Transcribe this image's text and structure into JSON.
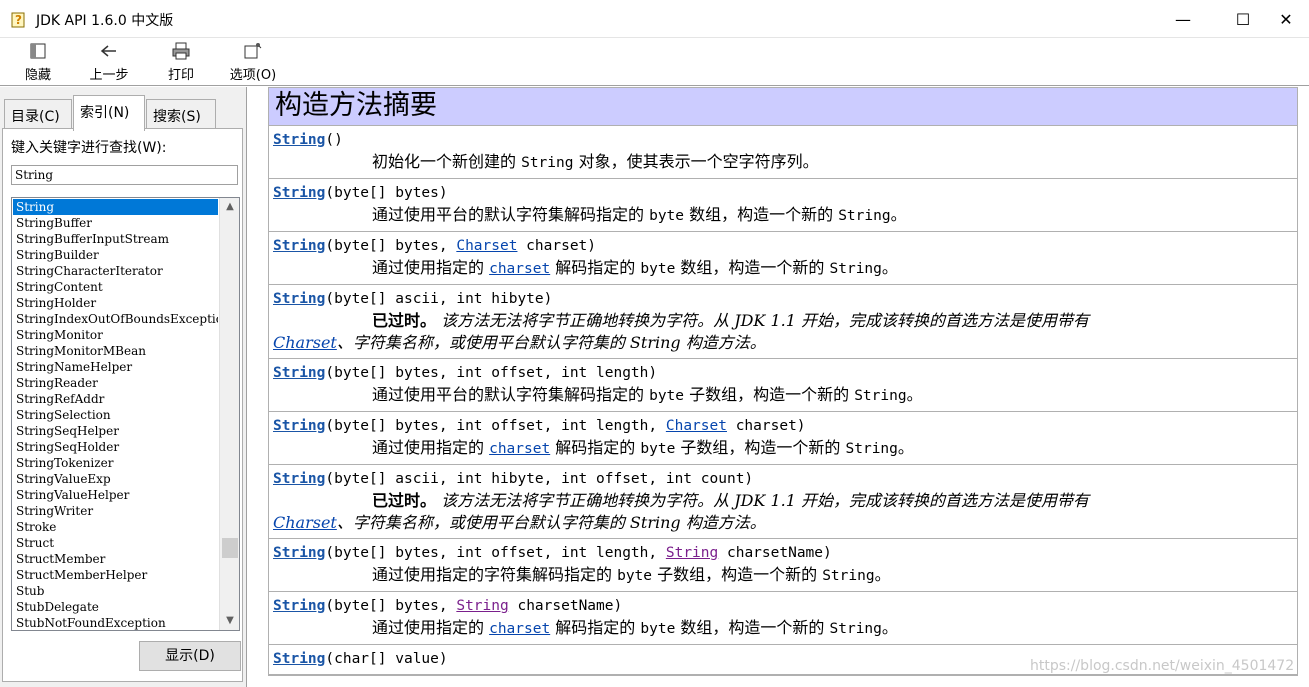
{
  "window": {
    "title": "JDK API 1.6.0 中文版",
    "min_glyph": "—",
    "max_glyph": "☐",
    "close_glyph": "✕"
  },
  "toolbar": {
    "hide_label": "隐藏",
    "back_label": "上一步",
    "print_label": "打印",
    "options_label": "选项(O)"
  },
  "tabs": {
    "contents": "目录(C)",
    "index": "索引(N)",
    "search": "搜索(S)"
  },
  "index": {
    "keyword_label": "键入关键字进行查找(W):",
    "keyword_value": "String",
    "items": [
      "String",
      "StringBuffer",
      "StringBufferInputStream",
      "StringBuilder",
      "StringCharacterIterator",
      "StringContent",
      "StringHolder",
      "StringIndexOutOfBoundsException",
      "StringMonitor",
      "StringMonitorMBean",
      "StringNameHelper",
      "StringReader",
      "StringRefAddr",
      "StringSelection",
      "StringSeqHelper",
      "StringSeqHolder",
      "StringTokenizer",
      "StringValueExp",
      "StringValueHelper",
      "StringWriter",
      "Stroke",
      "Struct",
      "StructMember",
      "StructMemberHelper",
      "Stub",
      "StubDelegate",
      "StubNotFoundException"
    ],
    "selected_item": "String",
    "show_button": "显示(D)"
  },
  "summary": {
    "heading": "构造方法摘要",
    "rows": [
      {
        "ctor": "String",
        "params": "()",
        "desc_pre": "初始化一个新创建的 ",
        "desc_code": "String",
        "desc_post": " 对象，使其表示一个空字符序列。"
      },
      {
        "ctor": "String",
        "params": "(byte[] bytes)",
        "desc_pre": "通过使用平台的默认字符集解码指定的 ",
        "desc_code": "byte",
        "desc_mid": " 数组，构造一个新的 ",
        "desc_code2": "String",
        "desc_post": "。"
      },
      {
        "ctor": "String",
        "params_pre": "(byte[] bytes, ",
        "link": "Charset",
        "params_post": " charset)",
        "desc_pre": "通过使用指定的 ",
        "desc_link": "charset",
        "desc_mid": " 解码指定的 ",
        "desc_code": "byte",
        "desc_mid2": " 数组，构造一个新的 ",
        "desc_code2": "String",
        "desc_post": "。"
      },
      {
        "ctor": "String",
        "params": "(byte[] ascii, int hibyte)",
        "dep_bold": "已过时。",
        "dep_text": " 该方法无法将字节正确地转换为字符。从 JDK 1.1 开始，完成该转换的首选方法是使用带有",
        "dep_link": "Charset",
        "dep_text2": "、字符集名称，或使用平台默认字符集的 String 构造方法。"
      },
      {
        "ctor": "String",
        "params": "(byte[] bytes, int offset, int length)",
        "desc_pre": "通过使用平台的默认字符集解码指定的 ",
        "desc_code": "byte",
        "desc_mid": " 子数组，构造一个新的 ",
        "desc_code2": "String",
        "desc_post": "。"
      },
      {
        "ctor": "String",
        "params_pre": "(byte[] bytes, int offset, int length, ",
        "link": "Charset",
        "params_post": " charset)",
        "desc_pre": "通过使用指定的 ",
        "desc_link": "charset",
        "desc_mid": " 解码指定的 ",
        "desc_code": "byte",
        "desc_mid2": " 子数组，构造一个新的 ",
        "desc_code2": "String",
        "desc_post": "。"
      },
      {
        "ctor": "String",
        "params": "(byte[] ascii, int hibyte, int offset, int count)",
        "dep_bold": "已过时。",
        "dep_text": " 该方法无法将字节正确地转换为字符。从 JDK 1.1 开始，完成该转换的首选方法是使用带有",
        "dep_link": "Charset",
        "dep_text2": "、字符集名称，或使用平台默认字符集的 String 构造方法。"
      },
      {
        "ctor": "String",
        "params_pre": "(byte[] bytes, int offset, int length, ",
        "link": "String",
        "params_post": " charsetName)",
        "desc_pre": "通过使用指定的字符集解码指定的 ",
        "desc_code": "byte",
        "desc_mid": " 子数组，构造一个新的 ",
        "desc_code2": "String",
        "desc_post": "。"
      },
      {
        "ctor": "String",
        "params_pre": "(byte[] bytes, ",
        "link": "String",
        "params_post": " charsetName)",
        "desc_pre": "通过使用指定的 ",
        "desc_link": "charset",
        "desc_mid": " 解码指定的 ",
        "desc_code": "byte",
        "desc_mid2": " 数组，构造一个新的 ",
        "desc_code2": "String",
        "desc_post": "。"
      },
      {
        "ctor": "String",
        "params": "(char[] value)"
      }
    ]
  },
  "watermark": "https://blog.csdn.net/weixin_4501472"
}
